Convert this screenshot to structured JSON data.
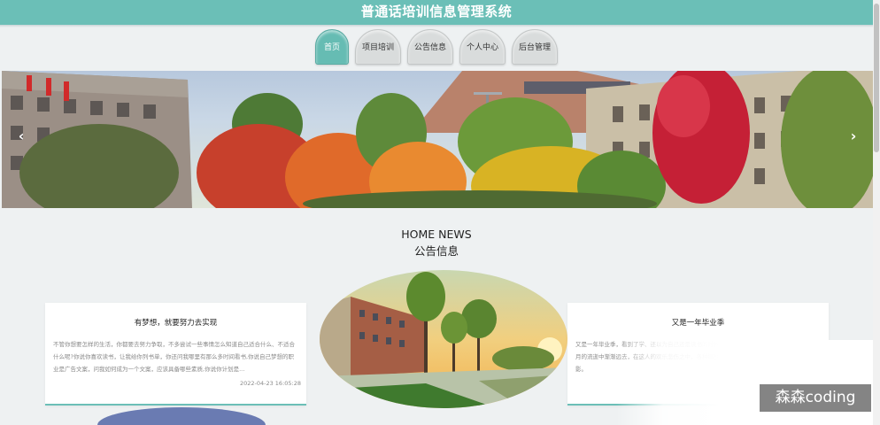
{
  "header": {
    "title": "普通话培训信息管理系统"
  },
  "nav": {
    "tabs": [
      {
        "label": "首页",
        "active": true
      },
      {
        "label": "项目培训",
        "active": false
      },
      {
        "label": "公告信息",
        "active": false
      },
      {
        "label": "个人中心",
        "active": false
      },
      {
        "label": "后台管理",
        "active": false
      }
    ]
  },
  "banner": {
    "prev_icon": "‹",
    "next_icon": "›"
  },
  "news": {
    "heading_en": "HOME NEWS",
    "heading_cn": "公告信息",
    "cards": [
      {
        "title": "有梦想，就要努力去实现",
        "body": "不管你想要怎样的生活，你都要去努力争取，不多尝试一些事情怎么知道自己适合什么、不适合什么呢?你说你喜欢读书，让我给你列书单，你还问我哪里有那么多时间看书,你说自己梦想的职业是广告文案，问我如何成为一个文案，应该具备哪些素质,你说你计划是...",
        "date": "2022-04-23 16:05:28"
      },
      {
        "title": "又是一年毕业季",
        "body": "又是一年毕业季，看到了学、还以为自己还是读书的时候的想法，那些在学校里的点点滴滴在岁月的流逝中渐渐远去，在这人的欢乐悲伤之中，各种挑战已跃入眼帘，光阴易逝，移，浮光掠影。"
      }
    ]
  },
  "watermark": "森森coding",
  "colors": {
    "accent": "#6bbfb7",
    "background": "#eef1f2"
  }
}
